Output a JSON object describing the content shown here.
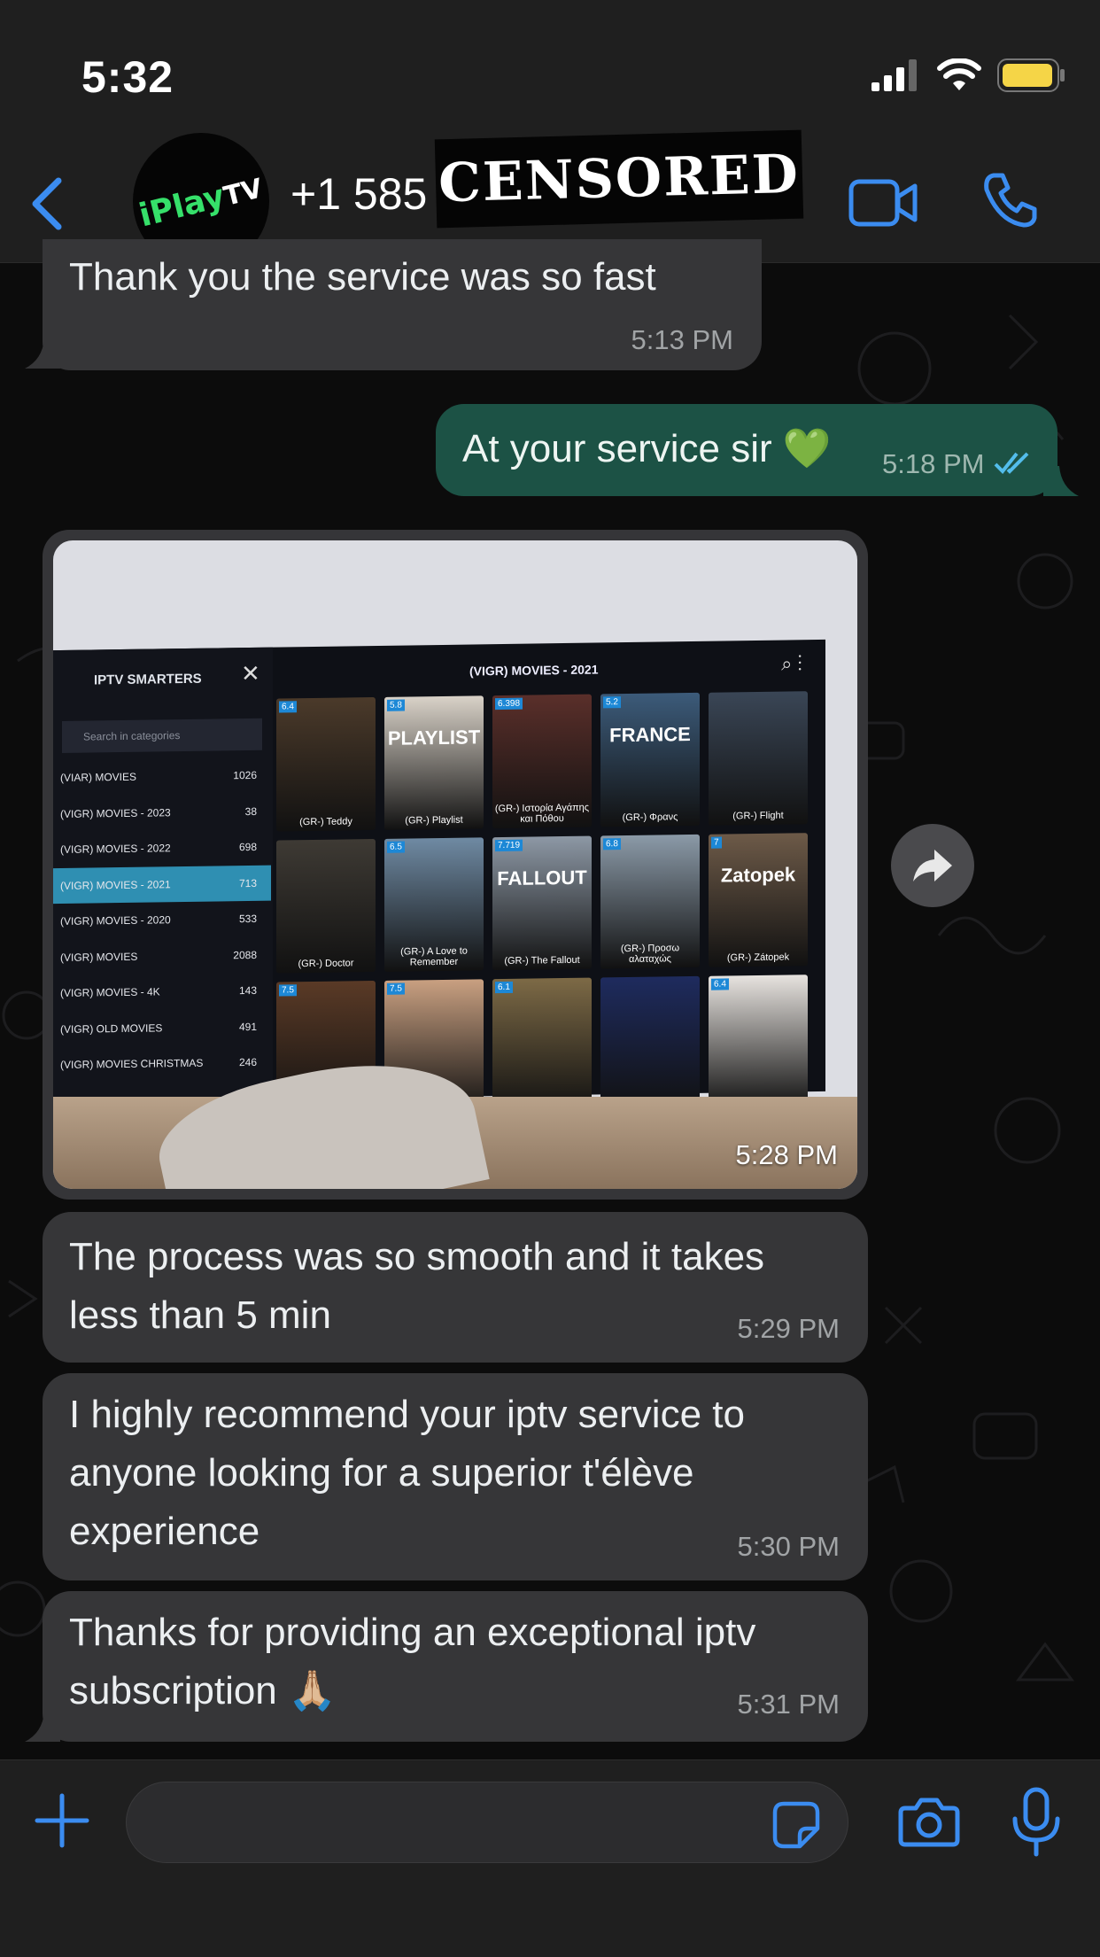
{
  "status_bar": {
    "time": "5:32"
  },
  "header": {
    "contact_name": "+1 585",
    "censored_label": "CENSORED",
    "avatar_logo": {
      "prefix": "iPlay",
      "suffix": "TV"
    }
  },
  "messages": [
    {
      "direction": "incoming",
      "text": "Thank you the service was so fast",
      "time": "5:13 PM"
    },
    {
      "direction": "outgoing",
      "text": "At your service sir 💚",
      "time": "5:18 PM",
      "status": "read"
    },
    {
      "direction": "incoming",
      "type": "image",
      "time": "5:28 PM"
    },
    {
      "direction": "incoming",
      "text_lines": [
        "The process was so smooth and it takes",
        "less than 5 min"
      ],
      "time": "5:29 PM"
    },
    {
      "direction": "incoming",
      "text_lines": [
        "I highly recommend your iptv service to",
        "anyone looking for a superior t'élève",
        "experience"
      ],
      "time": "5:30 PM"
    },
    {
      "direction": "incoming",
      "text_lines": [
        "Thanks for providing an exceptional iptv",
        "subscription 🙏🏼"
      ],
      "time": "5:31 PM"
    }
  ],
  "image_content": {
    "brand": "IPTV SMARTERS",
    "search_placeholder": "Search in categories",
    "title": "(VIGR) MOVIES - 2021",
    "categories": [
      {
        "name": "(VIAR) MOVIES",
        "count": "1026"
      },
      {
        "name": "(VIGR) MOVIES - 2023",
        "count": "38"
      },
      {
        "name": "(VIGR) MOVIES - 2022",
        "count": "698"
      },
      {
        "name": "(VIGR) MOVIES - 2021",
        "count": "713"
      },
      {
        "name": "(VIGR) MOVIES - 2020",
        "count": "533"
      },
      {
        "name": "(VIGR) MOVIES",
        "count": "2088"
      },
      {
        "name": "(VIGR) MOVIES - 4K",
        "count": "143"
      },
      {
        "name": "(VIGR) OLD MOVIES",
        "count": "491"
      },
      {
        "name": "(VIGR) MOVIES CHRISTMAS",
        "count": "246"
      }
    ],
    "posters": [
      {
        "title": "(GR-) Teddy",
        "badge": "6.4",
        "word": "",
        "color": "#4b3a2a"
      },
      {
        "title": "(GR-) Playlist",
        "badge": "5.8",
        "word": "PLAYLIST",
        "color": "#d9d2c8"
      },
      {
        "title": "(GR-) Ιστορία Αγάπης και Πόθου",
        "badge": "6.398",
        "word": "",
        "color": "#5a2f2a"
      },
      {
        "title": "(GR-) Φρανς",
        "badge": "5.2",
        "word": "FRANCE",
        "color": "#3c5b7a"
      },
      {
        "title": "(GR-) Flight",
        "badge": "",
        "word": "",
        "color": "#3a4656"
      },
      {
        "title": "(GR-) Doctor",
        "badge": "",
        "word": "",
        "color": "#3e3a34"
      },
      {
        "title": "(GR-) A Love to Remember",
        "badge": "6.5",
        "word": "",
        "color": "#6f8aa3"
      },
      {
        "title": "(GR-) The Fallout",
        "badge": "7.719",
        "word": "FALLOUT",
        "color": "#8d98a5"
      },
      {
        "title": "(GR-) Προσω αλαταχώς",
        "badge": "6.8",
        "word": "",
        "color": "#8b9aa8"
      },
      {
        "title": "(GR-) Zátopek",
        "badge": "7",
        "word": "Zatopek",
        "color": "#6d5a48"
      },
      {
        "title": "",
        "badge": "7.5",
        "word": "",
        "color": "#5a3a26"
      },
      {
        "title": "",
        "badge": "7.5",
        "word": "",
        "color": "#c9a081"
      },
      {
        "title": "",
        "badge": "6.1",
        "word": "",
        "color": "#7d6a46"
      },
      {
        "title": "",
        "badge": "",
        "word": "",
        "color": "#1e2b5e"
      },
      {
        "title": "",
        "badge": "6.4",
        "word": "",
        "color": "#e7e3df"
      }
    ]
  },
  "colors": {
    "accent": "#3b8cf0",
    "incoming_bubble": "#363638",
    "outgoing_bubble": "#1c5245"
  },
  "input": {
    "placeholder": "",
    "value": ""
  },
  "icons": [
    "back-icon",
    "video-call-icon",
    "phone-icon",
    "forward-icon",
    "plus-icon",
    "sticker-icon",
    "camera-icon",
    "mic-icon",
    "signal-icon",
    "wifi-icon",
    "battery-icon",
    "double-check-icon"
  ]
}
